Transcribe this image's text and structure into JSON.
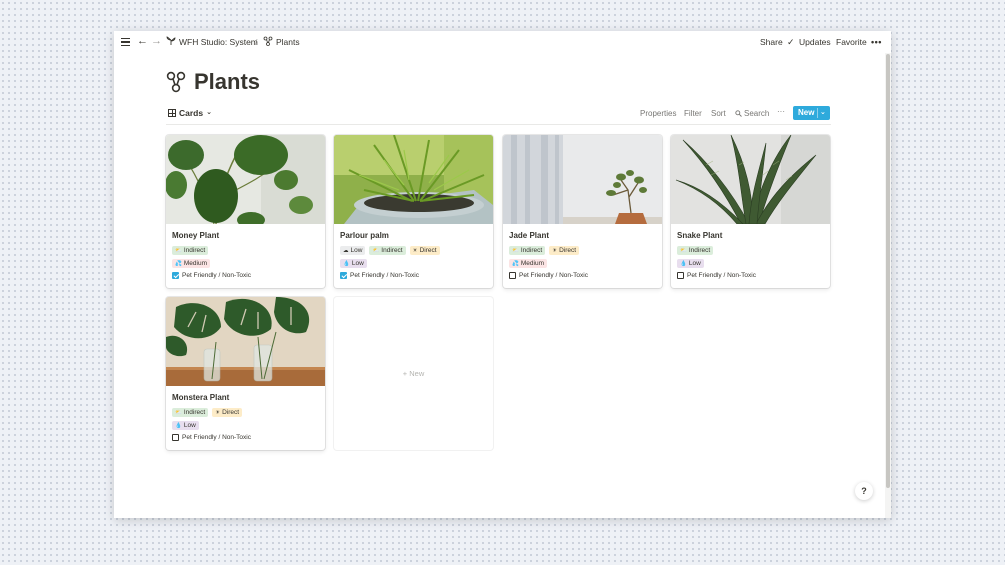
{
  "topbar": {
    "breadcrumb": [
      {
        "icon": "workspace-icon",
        "label": "WFH Studio: System"
      },
      {
        "icon": "plant-icon",
        "label": "Plants"
      }
    ],
    "separator": "/",
    "share_label": "Share",
    "updates_label": "Updates",
    "favorite_label": "Favorite",
    "more_label": "•••"
  },
  "page": {
    "title": "Plants",
    "icon": "plant-icon"
  },
  "view": {
    "name": "Cards",
    "properties_label": "Properties",
    "filter_label": "Filter",
    "sort_label": "Sort",
    "search_label": "Search",
    "more_label": "···",
    "new_label": "New"
  },
  "cards": [
    {
      "name": "Money Plant",
      "image": "money-plant-photo",
      "tags": [
        [
          "Indirect"
        ],
        [
          "Medium"
        ]
      ],
      "pet_friendly_label": "Pet Friendly / Non-Toxic",
      "pet_friendly": true
    },
    {
      "name": "Parlour palm",
      "image": "parlour-palm-photo",
      "tags": [
        [
          "Low",
          "Indirect",
          "Direct"
        ],
        [
          "Low"
        ]
      ],
      "pet_friendly_label": "Pet Friendly / Non-Toxic",
      "pet_friendly": true
    },
    {
      "name": "Jade Plant",
      "image": "jade-plant-photo",
      "tags": [
        [
          "Indirect",
          "Direct"
        ],
        [
          "Medium"
        ]
      ],
      "pet_friendly_label": "Pet Friendly / Non-Toxic",
      "pet_friendly": false
    },
    {
      "name": "Snake Plant",
      "image": "snake-plant-photo",
      "tags": [
        [
          "Indirect"
        ],
        [
          "Low"
        ]
      ],
      "pet_friendly_label": "Pet Friendly / Non-Toxic",
      "pet_friendly": false
    },
    {
      "name": "Monstera Plant",
      "image": "monstera-plant-photo",
      "tags": [
        [
          "Indirect",
          "Direct"
        ],
        [
          "Low"
        ]
      ],
      "pet_friendly_label": "Pet Friendly / Non-Toxic",
      "pet_friendly": false
    }
  ],
  "new_card_label": "+ New",
  "help_label": "?",
  "colors": {
    "accent": "#2eaadc",
    "tag_light_low": "#ebeced",
    "tag_light_indirect": "#dbeddb",
    "tag_light_direct": "#fdecc8",
    "tag_water_medium": "#fbe4e4",
    "tag_water_low": "#e8deee",
    "text": "#37352f"
  }
}
